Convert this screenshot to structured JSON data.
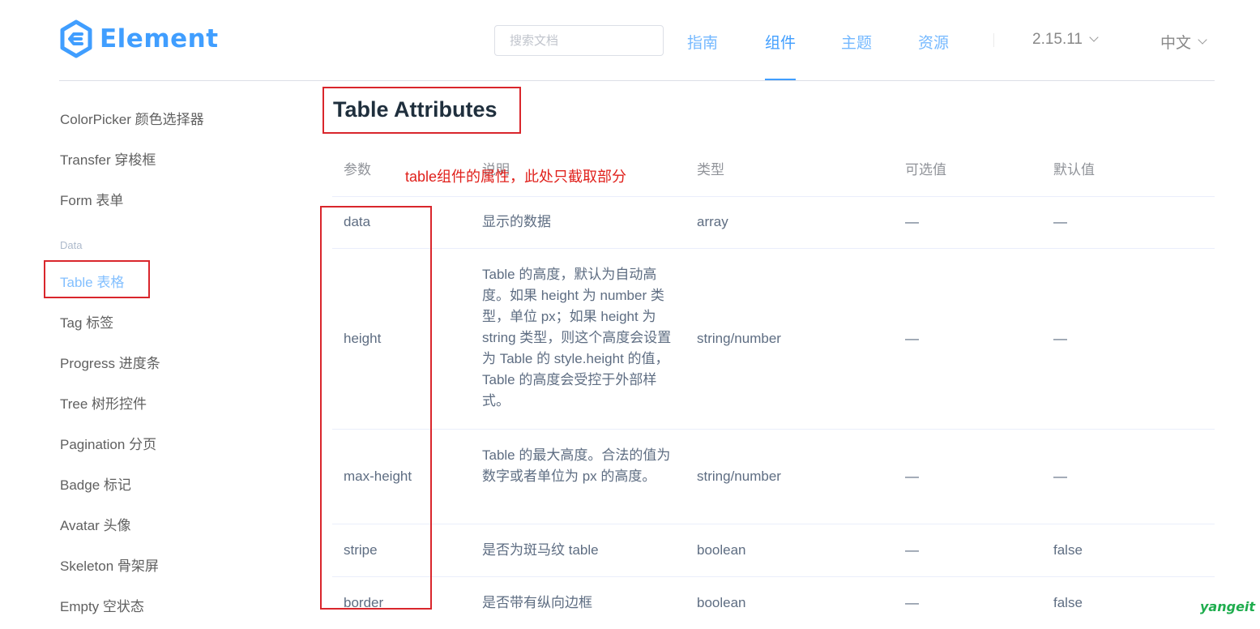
{
  "header": {
    "logo_text": "Element",
    "search_placeholder": "搜索文档",
    "nav": [
      {
        "label": "指南"
      },
      {
        "label": "组件"
      },
      {
        "label": "主题"
      },
      {
        "label": "资源"
      }
    ],
    "active_nav": "组件",
    "version": "2.15.11",
    "language": "中文"
  },
  "sidebar": {
    "items_top": [
      {
        "label": "ColorPicker 颜色选择器"
      },
      {
        "label": "Transfer 穿梭框"
      },
      {
        "label": "Form 表单"
      }
    ],
    "group_label": "Data",
    "items_data": [
      {
        "label": "Table 表格"
      },
      {
        "label": "Tag 标签"
      },
      {
        "label": "Progress 进度条"
      },
      {
        "label": "Tree 树形控件"
      },
      {
        "label": "Pagination 分页"
      },
      {
        "label": "Badge 标记"
      },
      {
        "label": "Avatar 头像"
      },
      {
        "label": "Skeleton 骨架屏"
      },
      {
        "label": "Empty 空状态"
      }
    ]
  },
  "main": {
    "title": "Table Attributes",
    "annotation": "table组件的属性，此处只截取部分",
    "table": {
      "headers": [
        "参数",
        "说明",
        "类型",
        "可选值",
        "默认值"
      ],
      "rows": [
        {
          "param": "data",
          "desc": "显示的数据",
          "type": "array",
          "options": "—",
          "default": "—"
        },
        {
          "param": "height",
          "desc": "Table 的高度，默认为自动高度。如果 height 为 number 类型，单位 px；如果 height 为 string 类型，则这个高度会设置为 Table 的 style.height 的值，Table 的高度会受控于外部样式。",
          "type": "string/number",
          "options": "—",
          "default": "—"
        },
        {
          "param": "max-height",
          "desc": "Table 的最大高度。合法的值为数字或者单位为 px 的高度。",
          "type": "string/number",
          "options": "—",
          "default": "—"
        },
        {
          "param": "stripe",
          "desc": "是否为斑马纹 table",
          "type": "boolean",
          "options": "—",
          "default": "false"
        },
        {
          "param": "border",
          "desc": "是否带有纵向边框",
          "type": "boolean",
          "options": "—",
          "default": "false"
        }
      ]
    }
  },
  "watermark": "yangeit",
  "colors": {
    "brand": "#409eff",
    "annotation_red": "#d9262c",
    "watermark_green": "#1fad4e"
  }
}
